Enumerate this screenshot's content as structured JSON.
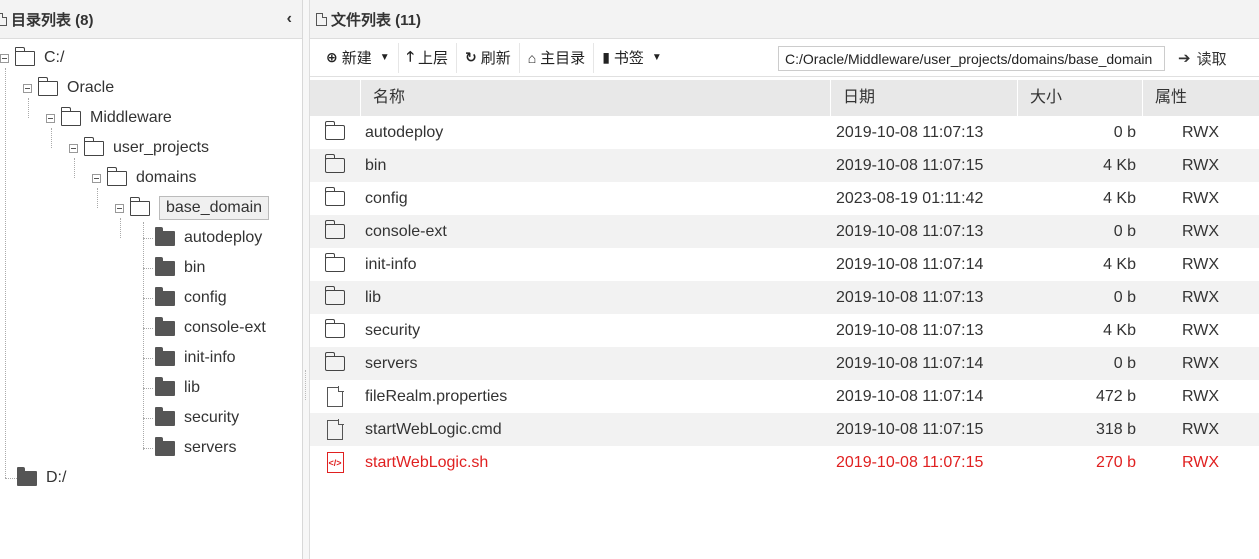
{
  "left_panel": {
    "title": "目录列表 (8)",
    "collapse_glyph": "‹",
    "tree": {
      "root_c": "C:/",
      "oracle": "Oracle",
      "middleware": "Middleware",
      "user_projects": "user_projects",
      "domains": "domains",
      "base_domain": "base_domain",
      "children": [
        "autodeploy",
        "bin",
        "config",
        "console-ext",
        "init-info",
        "lib",
        "security",
        "servers"
      ],
      "root_d": "D:/"
    }
  },
  "right_panel": {
    "title": "文件列表 (11)",
    "toolbar": {
      "new_label": "新建",
      "up_label": "上层",
      "refresh_label": "刷新",
      "home_label": "主目录",
      "bookmark_label": "书签",
      "path_value": "C:/Oracle/Middleware/user_projects/domains/base_domain",
      "read_label": "读取"
    },
    "columns": {
      "name": "名称",
      "date": "日期",
      "size": "大小",
      "attr": "属性"
    },
    "files": [
      {
        "name": "autodeploy",
        "date": "2019-10-08 11:07:13",
        "size": "0 b",
        "attr": "RWX",
        "icon": "folder-icon"
      },
      {
        "name": "bin",
        "date": "2019-10-08 11:07:15",
        "size": "4 Kb",
        "attr": "RWX",
        "icon": "folder-icon"
      },
      {
        "name": "config",
        "date": "2023-08-19 01:11:42",
        "size": "4 Kb",
        "attr": "RWX",
        "icon": "folder-icon"
      },
      {
        "name": "console-ext",
        "date": "2019-10-08 11:07:13",
        "size": "0 b",
        "attr": "RWX",
        "icon": "folder-icon"
      },
      {
        "name": "init-info",
        "date": "2019-10-08 11:07:14",
        "size": "4 Kb",
        "attr": "RWX",
        "icon": "folder-icon"
      },
      {
        "name": "lib",
        "date": "2019-10-08 11:07:13",
        "size": "0 b",
        "attr": "RWX",
        "icon": "folder-icon"
      },
      {
        "name": "security",
        "date": "2019-10-08 11:07:13",
        "size": "4 Kb",
        "attr": "RWX",
        "icon": "folder-icon"
      },
      {
        "name": "servers",
        "date": "2019-10-08 11:07:14",
        "size": "0 b",
        "attr": "RWX",
        "icon": "folder-icon"
      },
      {
        "name": "fileRealm.properties",
        "date": "2019-10-08 11:07:14",
        "size": "472 b",
        "attr": "RWX",
        "icon": "file-icon"
      },
      {
        "name": "startWebLogic.cmd",
        "date": "2019-10-08 11:07:15",
        "size": "318 b",
        "attr": "RWX",
        "icon": "file-icon"
      },
      {
        "name": "startWebLogic.sh",
        "date": "2019-10-08 11:07:15",
        "size": "270 b",
        "attr": "RWX",
        "icon": "code-file-icon",
        "highlight": "#e02020"
      }
    ]
  }
}
